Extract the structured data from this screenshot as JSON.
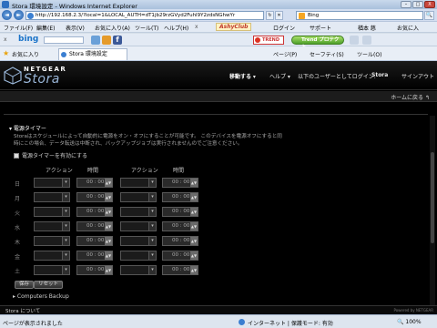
{
  "window": {
    "title": "Stora 環境設定 - Windows Internet Explorer",
    "buttons": {
      "minimize": "–",
      "maximize": "□",
      "close": "X"
    }
  },
  "address": {
    "url": "http://192.168.2.3/?local=1&LOCAL_AUTH=dT1jb29rzGVyd2Fuhl9Y2zdsNGhwYr",
    "back": "◄",
    "forward": "►",
    "refresh": "↻",
    "stop": "✕"
  },
  "search": {
    "placeholder": "Bing",
    "go": "🔍"
  },
  "menu": {
    "items": [
      "ファイル(F)",
      "編集(E)",
      "表示(V)",
      "お気に入り(A)",
      "ツール(T)",
      "ヘルプ(H)"
    ],
    "close": "x",
    "ashyclub": "AshyClub",
    "right": [
      "ログイン",
      "サポート",
      "楢本 慈",
      "お気に入"
    ]
  },
  "bing_toolbar": {
    "close": "x",
    "logo": "bing",
    "trend": "TREND",
    "trend_pro": "Trend プロテクト"
  },
  "favorites": {
    "label": "お気に入り",
    "tab": "Stora 環境設定",
    "commands": [
      "ページ(P)",
      "セーフティ(S)",
      "ツール(O)"
    ]
  },
  "header": {
    "brand": "NETGEAR",
    "product": "Stora",
    "nav": [
      "移動する",
      "ヘルプ",
      "以下のユーザーとしてログイン:",
      "Stora",
      "サインアウト"
    ]
  },
  "home_link": "ホームに戻る ↰",
  "power_timer": {
    "title": "電源タイマー",
    "description": "Storaはスケジュールによって自動的に電源をオン・オフにすることが可能です。 このデバイスを電源オフにすると同時にこの場合、データ転送は中断され、バックアップジョブは実行されませんのでご注意ください。",
    "enable_label": "電源タイマーを有効にする",
    "columns": {
      "action": "アクション",
      "time": "時間"
    },
    "days": [
      "日",
      "月",
      "火",
      "水",
      "木",
      "金",
      "土"
    ],
    "time_value": "00 : 00",
    "buttons": {
      "save": "保存",
      "reset": "リセット"
    }
  },
  "computers_backup": "Computers Backup",
  "footer": {
    "left": "Stora について",
    "right": "Powered by NETGEAR"
  },
  "status_bar": {
    "left": "ページが表示されました",
    "zone": "インターネット | 保護モード: 有効",
    "zoom": "100%"
  },
  "colors": {
    "page_bg": "#000000",
    "brand_blue": "#9ab7d9",
    "ie_chrome": "#d6dfe9"
  }
}
